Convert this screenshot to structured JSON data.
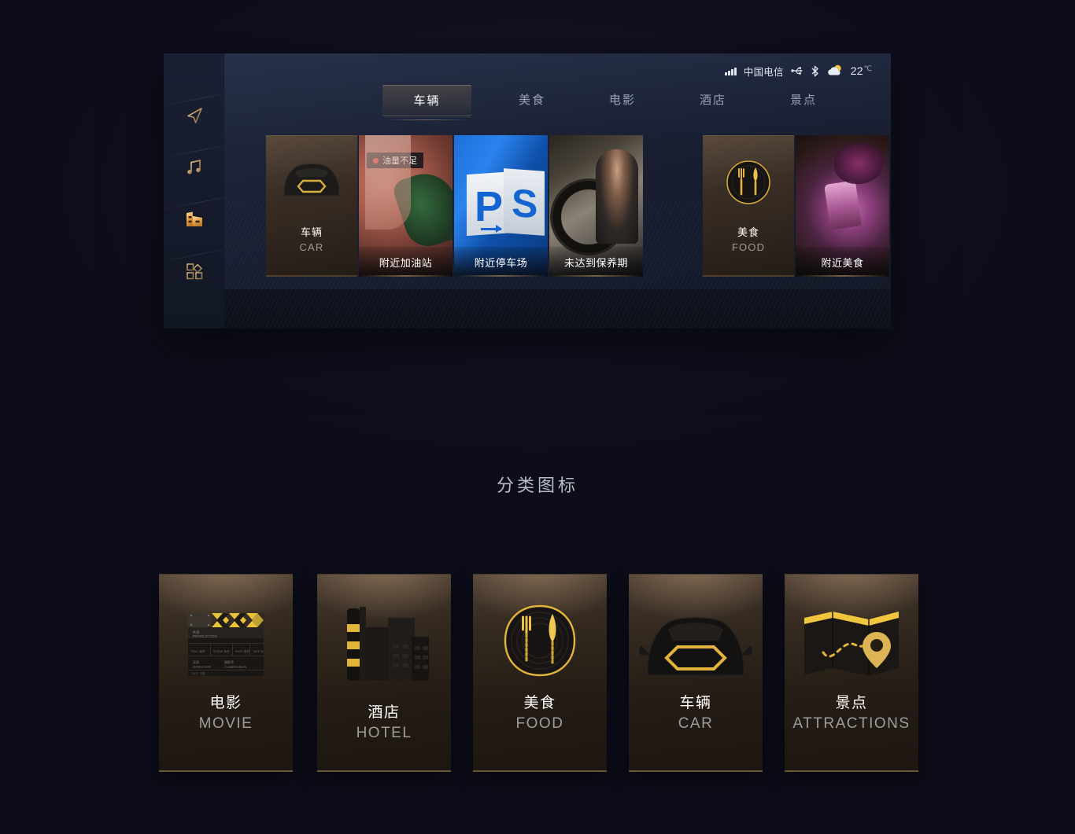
{
  "statusbar": {
    "signal_icon": "signal-bars-icon",
    "carrier": "中国电信",
    "usb_icon": "usb-icon",
    "bluetooth_icon": "bluetooth-icon",
    "weather_icon": "partly-cloudy-icon",
    "temperature": "22",
    "temperature_unit": "℃"
  },
  "sidebar": {
    "items": [
      {
        "name": "navigation-icon",
        "active": false
      },
      {
        "name": "music-icon",
        "active": false
      },
      {
        "name": "store-icon",
        "active": true
      },
      {
        "name": "apps-grid-icon",
        "active": false
      }
    ]
  },
  "tabs": [
    {
      "label": "车辆",
      "active": true
    },
    {
      "label": "美食",
      "active": false
    },
    {
      "label": "电影",
      "active": false
    },
    {
      "label": "酒店",
      "active": false
    },
    {
      "label": "景点",
      "active": false
    }
  ],
  "strip": {
    "groups": [
      {
        "category": {
          "cn": "车辆",
          "en": "CAR",
          "icon": "car-icon"
        },
        "photos": [
          {
            "label": "附近加油站",
            "badge": "油量不足",
            "badge_dot_color": "#e8342a",
            "image": "gas-station-photo"
          },
          {
            "label": "附近停车场",
            "badge": null,
            "image": "parking-sign-photo"
          },
          {
            "label": "未达到保养期",
            "badge": null,
            "image": "car-maintenance-photo"
          }
        ]
      },
      {
        "category": {
          "cn": "美食",
          "en": "FOOD",
          "icon": "cutlery-plate-icon"
        },
        "photos": [
          {
            "label": "附近美食",
            "badge": null,
            "image": "dessert-photo"
          }
        ]
      }
    ]
  },
  "section": {
    "title": "分类图标"
  },
  "category_cards": [
    {
      "cn": "电影",
      "en": "MOVIE",
      "icon": "clapperboard-icon"
    },
    {
      "cn": "酒店",
      "en": "HOTEL",
      "icon": "hotel-building-icon"
    },
    {
      "cn": "美食",
      "en": "FOOD",
      "icon": "cutlery-plate-icon"
    },
    {
      "cn": "车辆",
      "en": "CAR",
      "icon": "car-front-icon"
    },
    {
      "cn": "景点",
      "en": "ATTRACTIONS",
      "icon": "map-pin-icon"
    }
  ],
  "colors": {
    "gold": "#d8ab5c",
    "background": "#0d0d1a",
    "accent_red": "#e8342a"
  }
}
